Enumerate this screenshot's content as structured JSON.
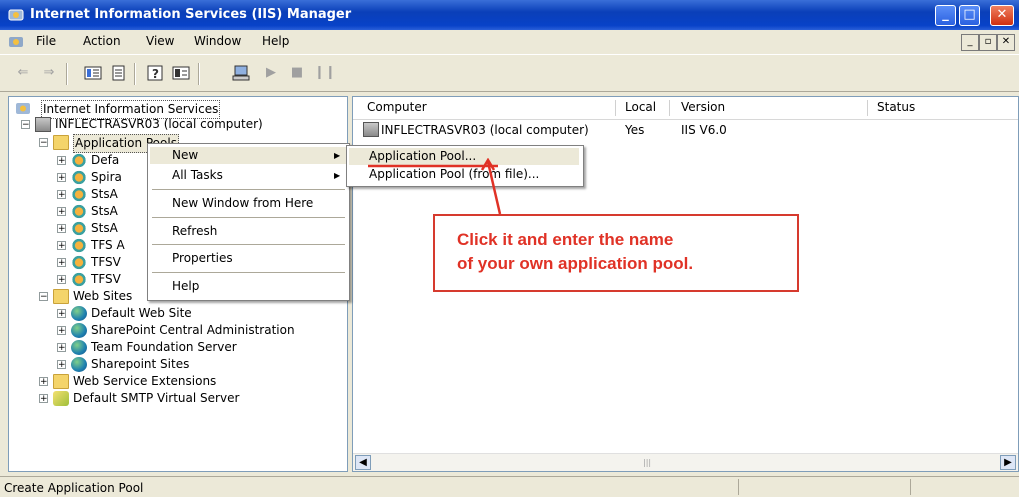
{
  "window": {
    "title": "Internet Information Services (IIS) Manager",
    "buttons": {
      "minimize": "_",
      "maximize": "□",
      "close": "✕"
    }
  },
  "menubar": {
    "items": [
      "File",
      "Action",
      "View",
      "Window",
      "Help"
    ],
    "mdi_buttons": [
      "_",
      "▫",
      "✕"
    ]
  },
  "tree": {
    "root": "Internet Information Services",
    "server": "INFLECTRASVR03 (local computer)",
    "app_pools": "Application Pools",
    "pool_items": [
      "Defa",
      "Spira",
      "StsA",
      "StsA",
      "StsA",
      "TFS A",
      "TFSV",
      "TFSV"
    ],
    "web_sites": "Web Sites",
    "site_items": [
      "Default Web Site",
      "SharePoint Central Administration",
      "Team Foundation Server",
      "Sharepoint Sites"
    ],
    "wse": "Web Service Extensions",
    "smtp": "Default SMTP Virtual Server"
  },
  "list": {
    "columns": [
      "Computer",
      "Local",
      "Version",
      "Status"
    ],
    "rows": [
      {
        "computer": "INFLECTRASVR03 (local computer)",
        "local": "Yes",
        "version": "IIS V6.0",
        "status": ""
      }
    ]
  },
  "context_menu": {
    "items": [
      "New",
      "All Tasks",
      "New Window from Here",
      "Refresh",
      "Properties",
      "Help"
    ]
  },
  "submenu": {
    "items": [
      "Application Pool...",
      "Application Pool (from file)..."
    ]
  },
  "callout": {
    "line1": "Click it and enter the name",
    "line2": "of your own application pool."
  },
  "statusbar": {
    "text": "Create Application Pool"
  },
  "colors": {
    "title_blue": "#0a3fb8",
    "callout_red": "#e03226",
    "pane_border": "#7f9db9"
  }
}
